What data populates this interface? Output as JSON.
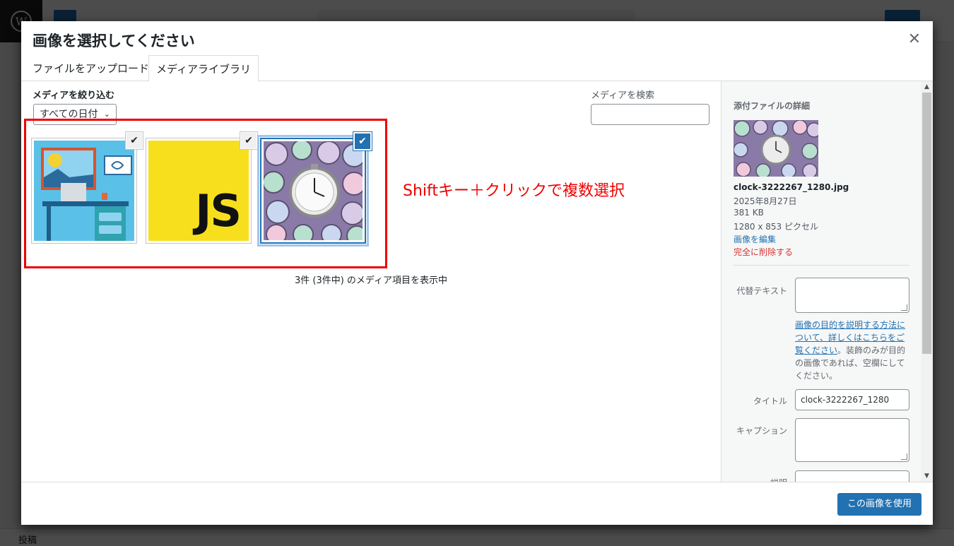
{
  "background": {
    "bottom_label": "投稿"
  },
  "modal": {
    "title": "画像を選択してください",
    "close_icon": "close-icon",
    "tabs": [
      {
        "label": "ファイルをアップロード",
        "active": false
      },
      {
        "label": "メディアライブラリ",
        "active": true
      }
    ]
  },
  "filters": {
    "label": "メディアを絞り込む",
    "date_select_value": "すべての日付",
    "search_label": "メディアを検索",
    "search_value": ""
  },
  "attachments": [
    {
      "name": "desk-illustration",
      "selected": true,
      "active": false
    },
    {
      "name": "js-logo",
      "text": "JS",
      "selected": true,
      "active": false
    },
    {
      "name": "clock-3222267_1280.jpg",
      "selected": true,
      "active": true
    }
  ],
  "annotation": {
    "text": "Shiftキー＋クリックで複数選択",
    "color": "#ee0000"
  },
  "count_text": "3件 (3件中) のメディア項目を表示中",
  "details": {
    "heading": "添付ファイルの詳細",
    "filename": "clock-3222267_1280.jpg",
    "date": "2025年8月27日",
    "size": "381 KB",
    "dimensions": "1280 x 853 ピクセル",
    "edit_link": "画像を編集",
    "delete_link": "完全に削除する",
    "alt_label": "代替テキスト",
    "alt_value": "",
    "alt_help_link": "画像の目的を説明する方法について、詳しくはこちらをご覧ください",
    "alt_help_rest": "。装飾のみが目的の画像であれば、空欄にしてください。",
    "title_label": "タイトル",
    "title_value": "clock-3222267_1280",
    "caption_label": "キャプション",
    "caption_value": "",
    "desc_label": "説明"
  },
  "toolbar": {
    "use_button": "この画像を使用"
  },
  "colors": {
    "accent": "#2271b1",
    "danger": "#d63638"
  }
}
